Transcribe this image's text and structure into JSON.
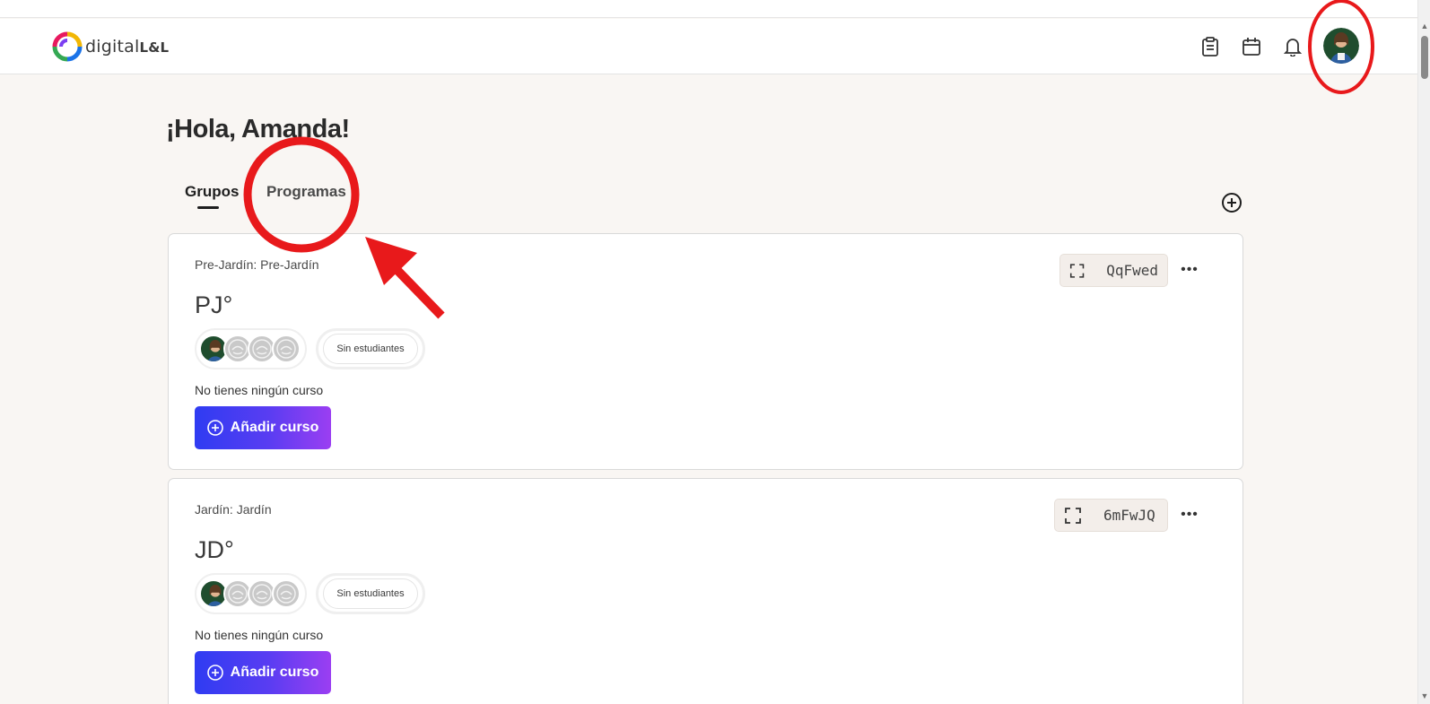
{
  "header": {
    "logo_text": "digital",
    "logo_text_bold": "L&L",
    "icons": [
      "clipboard-icon",
      "calendar-icon",
      "bell-icon",
      "user-avatar"
    ]
  },
  "greeting": "¡Hola, Amanda!",
  "tabs": [
    {
      "label": "Grupos",
      "active": true
    },
    {
      "label": "Programas",
      "active": false
    }
  ],
  "groups": [
    {
      "subtitle": "Pre-Jardín: Pre-Jardín",
      "title": "PJ°",
      "code": "QqFwed",
      "students_label": "Sin estudiantes",
      "no_course_text": "No tienes ningún curso",
      "add_course_label": "Añadir curso"
    },
    {
      "subtitle": "Jardín: Jardín",
      "title": "JD°",
      "code": "6mFwJQ",
      "students_label": "Sin estudiantes",
      "no_course_text": "No tienes ningún curso",
      "add_course_label": "Añadir curso"
    }
  ],
  "colors": {
    "accent_gradient_start": "#2f3cf2",
    "accent_gradient_end": "#9b3ef2",
    "annotation_red": "#e8191b",
    "page_background": "#f9f6f3"
  }
}
